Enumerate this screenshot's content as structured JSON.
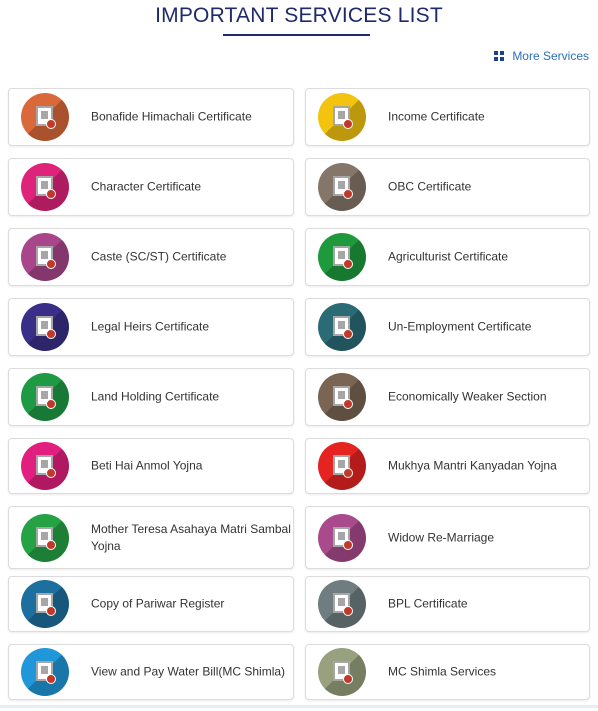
{
  "page": {
    "title": "IMPORTANT SERVICES LIST",
    "more_services": "More Services"
  },
  "colors": {
    "title": "#1f2a6b",
    "link": "#2c6fbd"
  },
  "left_services": [
    {
      "label": "Bonafide Himachali Certificate",
      "icon": "certificate-icon",
      "color": "#d9683a"
    },
    {
      "label": "Character Certificate",
      "icon": "certificate-icon",
      "color": "#e0237a"
    },
    {
      "label": "Caste (SC/ST) Certificate",
      "icon": "certificate-icon",
      "color": "#a9468b"
    },
    {
      "label": "Legal Heirs Certificate",
      "icon": "certificate-icon",
      "color": "#3a2f86"
    },
    {
      "label": "Land Holding Certificate",
      "icon": "land-icon",
      "color": "#1f9a44"
    },
    {
      "label": "Beti Hai Anmol Yojna",
      "icon": "girl-child-icon",
      "color": "#e21f7e"
    },
    {
      "label": "Mother Teresa Asahaya Matri Sambal Yojna",
      "icon": "mother-icon",
      "color": "#25a244"
    },
    {
      "label": "Copy of Pariwar Register",
      "icon": "register-icon",
      "color": "#1d6f9f"
    },
    {
      "label": "View and Pay Water Bill(MC Shimla)",
      "icon": "water-bill-icon",
      "color": "#1f97d8"
    }
  ],
  "right_services": [
    {
      "label": "Income Certificate",
      "icon": "certificate-icon",
      "color": "#f2c30f"
    },
    {
      "label": "OBC Certificate",
      "icon": "certificate-icon",
      "color": "#85766a"
    },
    {
      "label": "Agriculturist Certificate",
      "icon": "agriculture-icon",
      "color": "#1e9a3c"
    },
    {
      "label": "Un-Employment Certificate",
      "icon": "employment-icon",
      "color": "#2a6b76"
    },
    {
      "label": "Economically Weaker Section",
      "icon": "certificate-icon",
      "color": "#7a6552"
    },
    {
      "label": "Mukhya Mantri Kanyadan Yojna",
      "icon": "kanyadan-icon",
      "color": "#e52421"
    },
    {
      "label": "Widow Re-Marriage",
      "icon": "widow-icon",
      "color": "#a94a8c"
    },
    {
      "label": "BPL Certificate",
      "icon": "certificate-icon",
      "color": "#6f7d80"
    },
    {
      "label": "MC Shimla Services",
      "icon": "mc-shimla-icon",
      "color": "#97a17d"
    }
  ]
}
